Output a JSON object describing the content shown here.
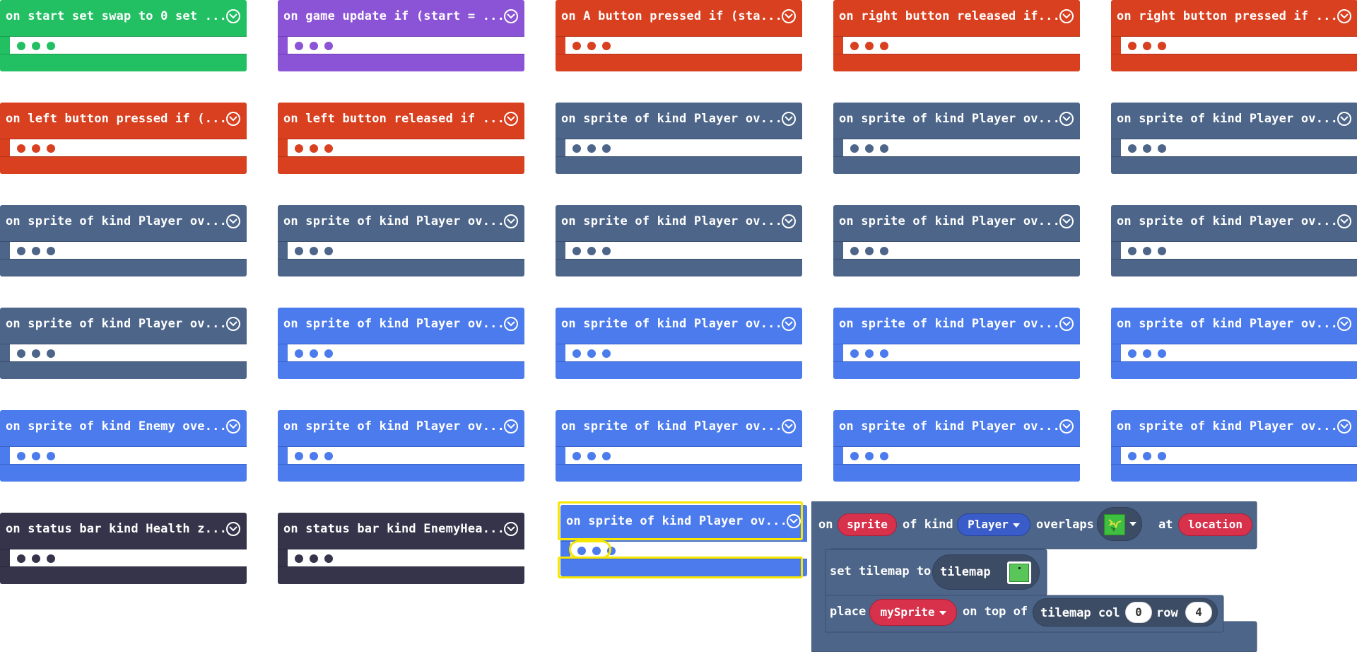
{
  "blocks": [
    {
      "label": "on start set swap to 0 set ...",
      "color": "#22c063",
      "dark": "#1a9a4e",
      "dot": "#22c063"
    },
    {
      "label": "on game update if (start = ...",
      "color": "#8b53d6",
      "dark": "#6e3fb3",
      "dot": "#8b53d6"
    },
    {
      "label": "on A button pressed if (sta...",
      "color": "#d9401f",
      "dark": "#b43217",
      "dot": "#d9401f"
    },
    {
      "label": "on right button released if...",
      "color": "#d9401f",
      "dark": "#b43217",
      "dot": "#d9401f"
    },
    {
      "label": "on right button pressed if ...",
      "color": "#d9401f",
      "dark": "#b43217",
      "dot": "#d9401f"
    },
    {
      "label": "on left button pressed if (...",
      "color": "#d9401f",
      "dark": "#b43217",
      "dot": "#d9401f"
    },
    {
      "label": "on left button released if ...",
      "color": "#d9401f",
      "dark": "#b43217",
      "dot": "#d9401f"
    },
    {
      "label": "on sprite of kind Player ov...",
      "color": "#4c6589",
      "dark": "#3b5070",
      "dot": "#4c6589"
    },
    {
      "label": "on sprite of kind Player ov...",
      "color": "#4c6589",
      "dark": "#3b5070",
      "dot": "#4c6589"
    },
    {
      "label": "on sprite of kind Player ov...",
      "color": "#4c6589",
      "dark": "#3b5070",
      "dot": "#4c6589"
    },
    {
      "label": "on sprite of kind Player ov...",
      "color": "#4c6589",
      "dark": "#3b5070",
      "dot": "#4c6589"
    },
    {
      "label": "on sprite of kind Player ov...",
      "color": "#4c6589",
      "dark": "#3b5070",
      "dot": "#4c6589"
    },
    {
      "label": "on sprite of kind Player ov...",
      "color": "#4c6589",
      "dark": "#3b5070",
      "dot": "#4c6589"
    },
    {
      "label": "on sprite of kind Player ov...",
      "color": "#4c6589",
      "dark": "#3b5070",
      "dot": "#4c6589"
    },
    {
      "label": "on sprite of kind Player ov...",
      "color": "#4c6589",
      "dark": "#3b5070",
      "dot": "#4c6589"
    },
    {
      "label": "on sprite of kind Player ov...",
      "color": "#4c6589",
      "dark": "#3b5070",
      "dot": "#4c6589"
    },
    {
      "label": "on sprite of kind Player ov...",
      "color": "#4b7bec",
      "dark": "#3a63c7",
      "dot": "#4b7bec"
    },
    {
      "label": "on sprite of kind Player ov...",
      "color": "#4b7bec",
      "dark": "#3a63c7",
      "dot": "#4b7bec"
    },
    {
      "label": "on sprite of kind Player ov...",
      "color": "#4b7bec",
      "dark": "#3a63c7",
      "dot": "#4b7bec"
    },
    {
      "label": "on sprite of kind Player ov...",
      "color": "#4b7bec",
      "dark": "#3a63c7",
      "dot": "#4b7bec"
    },
    {
      "label": "on sprite of kind Enemy ove...",
      "color": "#4b7bec",
      "dark": "#3a63c7",
      "dot": "#4b7bec"
    },
    {
      "label": "on sprite of kind Player ov...",
      "color": "#4b7bec",
      "dark": "#3a63c7",
      "dot": "#4b7bec"
    },
    {
      "label": "on sprite of kind Player ov...",
      "color": "#4b7bec",
      "dark": "#3a63c7",
      "dot": "#4b7bec"
    },
    {
      "label": "on sprite of kind Player ov...",
      "color": "#4b7bec",
      "dark": "#3a63c7",
      "dot": "#4b7bec"
    },
    {
      "label": "on sprite of kind Player ov...",
      "color": "#4b7bec",
      "dark": "#3a63c7",
      "dot": "#4b7bec"
    },
    {
      "label": "on status bar kind Health z...",
      "color": "#35344a",
      "dark": "#28273a",
      "dot": "#35344a"
    },
    {
      "label": "on status bar kind EnemyHea...",
      "color": "#35344a",
      "dark": "#28273a",
      "dot": "#35344a"
    },
    {
      "label": "on sprite of kind Player ov...",
      "color": "#4b7bec",
      "dark": "#3a63c7",
      "dot": "#4b7bec",
      "selected": true
    }
  ],
  "expanded": {
    "on": "on",
    "sprite": "sprite",
    "of_kind": "of kind",
    "kind": "Player",
    "overlaps": "overlaps",
    "at": "at",
    "location": "location",
    "set_tilemap": "set tilemap to",
    "tilemap": "tilemap",
    "place": "place",
    "mySprite": "mySprite",
    "on_top_of": "on top of",
    "tilemap_col": "tilemap col",
    "col": "0",
    "row_label": "row",
    "row": "4",
    "color": "#4c6589"
  }
}
